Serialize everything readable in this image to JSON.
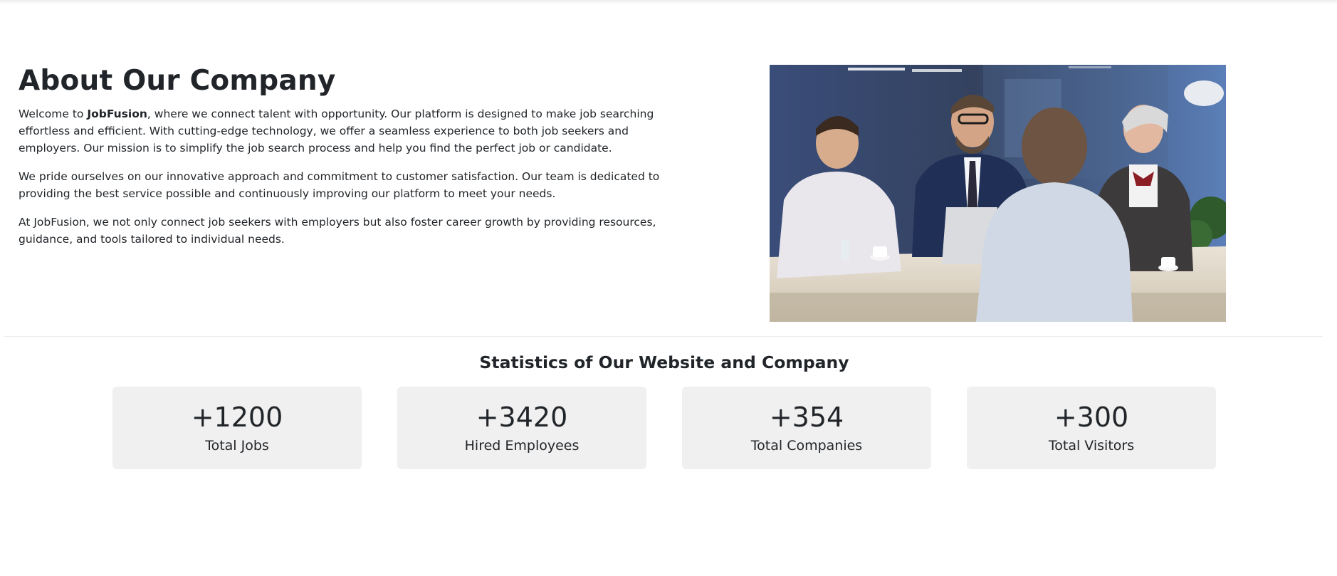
{
  "about": {
    "title": "About Our Company",
    "p1_prefix": "Welcome to ",
    "p1_brand": "JobFusion",
    "p1_rest": ", where we connect talent with opportunity. Our platform is designed to make job searching effortless and efficient. With cutting-edge technology, we offer a seamless experience to both job seekers and employers. Our mission is to simplify the job search process and help you find the perfect job or candidate.",
    "p2": "We pride ourselves on our innovative approach and commitment to customer satisfaction. Our team is dedicated to providing the best service possible and continuously improving our platform to meet your needs.",
    "p3": "At JobFusion, we not only connect job seekers with employers but also foster career growth by providing resources, guidance, and tools tailored to individual needs."
  },
  "stats": {
    "title": "Statistics of Our Website and Company",
    "items": [
      {
        "value": "+1200",
        "label": "Total Jobs"
      },
      {
        "value": "+3420",
        "label": "Hired Employees"
      },
      {
        "value": "+354",
        "label": "Total Companies"
      },
      {
        "value": "+300",
        "label": "Total Visitors"
      }
    ]
  },
  "colors": {
    "card_background": "#f0f0f0",
    "text": "#212529"
  }
}
